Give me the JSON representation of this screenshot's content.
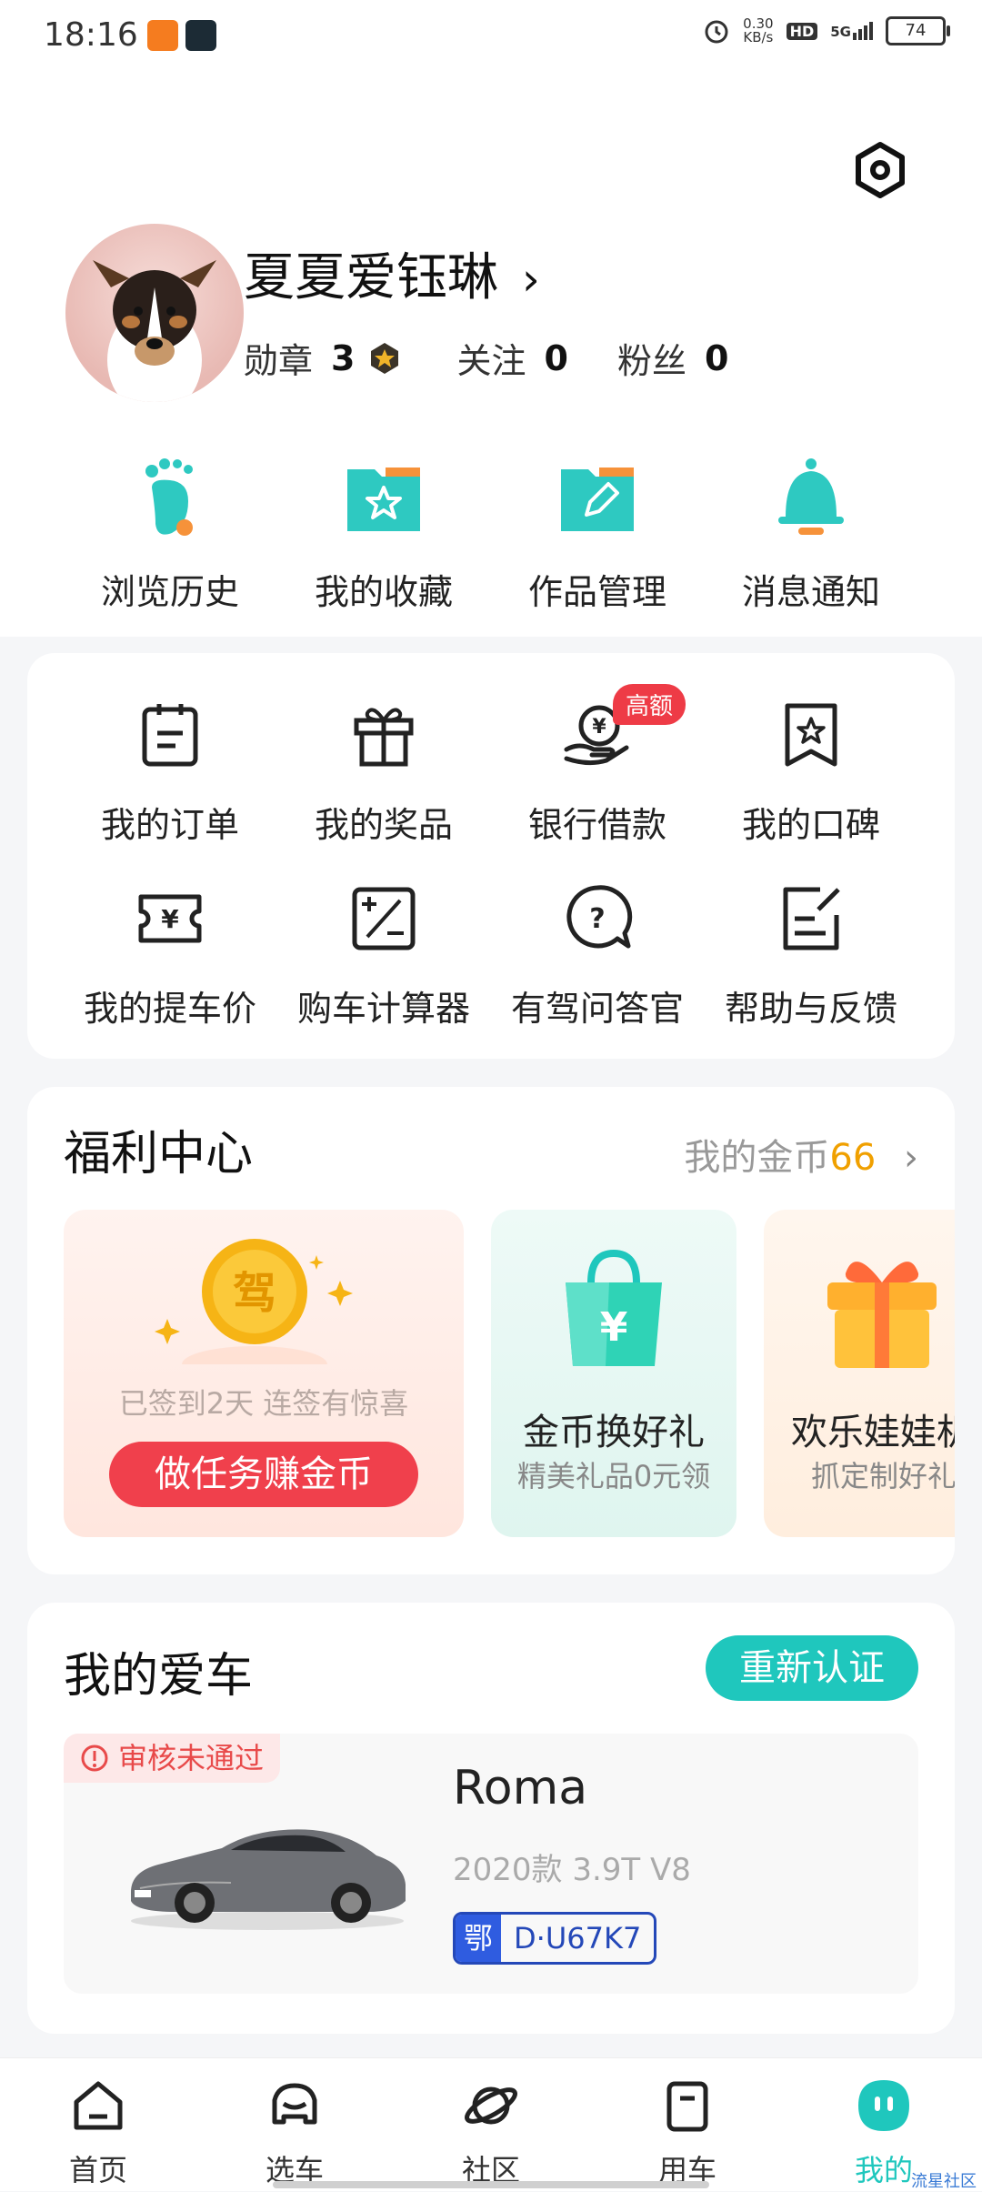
{
  "status": {
    "time": "18:16",
    "net_speed_value": "0.30",
    "net_speed_unit": "KB/s",
    "hd": "HD",
    "signal": "5G",
    "battery": "74"
  },
  "profile": {
    "username": "夏夏爱钰琳",
    "medal_label": "勋章",
    "medal_count": "3",
    "follow_label": "关注",
    "follow_count": "0",
    "fans_label": "粉丝",
    "fans_count": "0"
  },
  "quick_actions": [
    {
      "label": "浏览历史",
      "icon": "footprint-icon"
    },
    {
      "label": "我的收藏",
      "icon": "star-folder-icon"
    },
    {
      "label": "作品管理",
      "icon": "edit-folder-icon"
    },
    {
      "label": "消息通知",
      "icon": "bell-icon"
    }
  ],
  "services": [
    {
      "label": "我的订单",
      "icon": "order-icon"
    },
    {
      "label": "我的奖品",
      "icon": "gift-icon"
    },
    {
      "label": "银行借款",
      "icon": "loan-icon",
      "badge": "高额"
    },
    {
      "label": "我的口碑",
      "icon": "reputation-icon"
    },
    {
      "label": "我的提车价",
      "icon": "ticket-yuan-icon"
    },
    {
      "label": "购车计算器",
      "icon": "calculator-icon"
    },
    {
      "label": "有驾问答官",
      "icon": "question-icon"
    },
    {
      "label": "帮助与反馈",
      "icon": "feedback-icon"
    }
  ],
  "welfare": {
    "title": "福利中心",
    "coins_label": "我的金币",
    "coins_value": "66",
    "coin_char": "驾",
    "checkin_text": "已签到2天 连签有惊喜",
    "task_button": "做任务赚金币",
    "card2_title": "金币换好礼",
    "card2_sub": "精美礼品0元领",
    "card3_title": "欢乐娃娃机",
    "card3_sub": "抓定制好礼"
  },
  "mycar": {
    "title": "我的爱车",
    "recert_button": "重新认证",
    "status": "审核未通过",
    "model": "Roma",
    "spec": "2020款 3.9T V8",
    "plate_province": "鄂",
    "plate_number": "D·U67K7"
  },
  "tabs": [
    {
      "label": "首页",
      "icon": "home-icon"
    },
    {
      "label": "选车",
      "icon": "car-select-icon"
    },
    {
      "label": "社区",
      "icon": "planet-icon"
    },
    {
      "label": "用车",
      "icon": "car-use-icon"
    },
    {
      "label": "我的",
      "icon": "me-icon",
      "active": true
    }
  ],
  "watermark": "流星社区",
  "colors": {
    "accent": "#1fc7bd",
    "danger": "#f0404c",
    "gold": "#f0a000",
    "plate_blue": "#2f5ce0"
  }
}
